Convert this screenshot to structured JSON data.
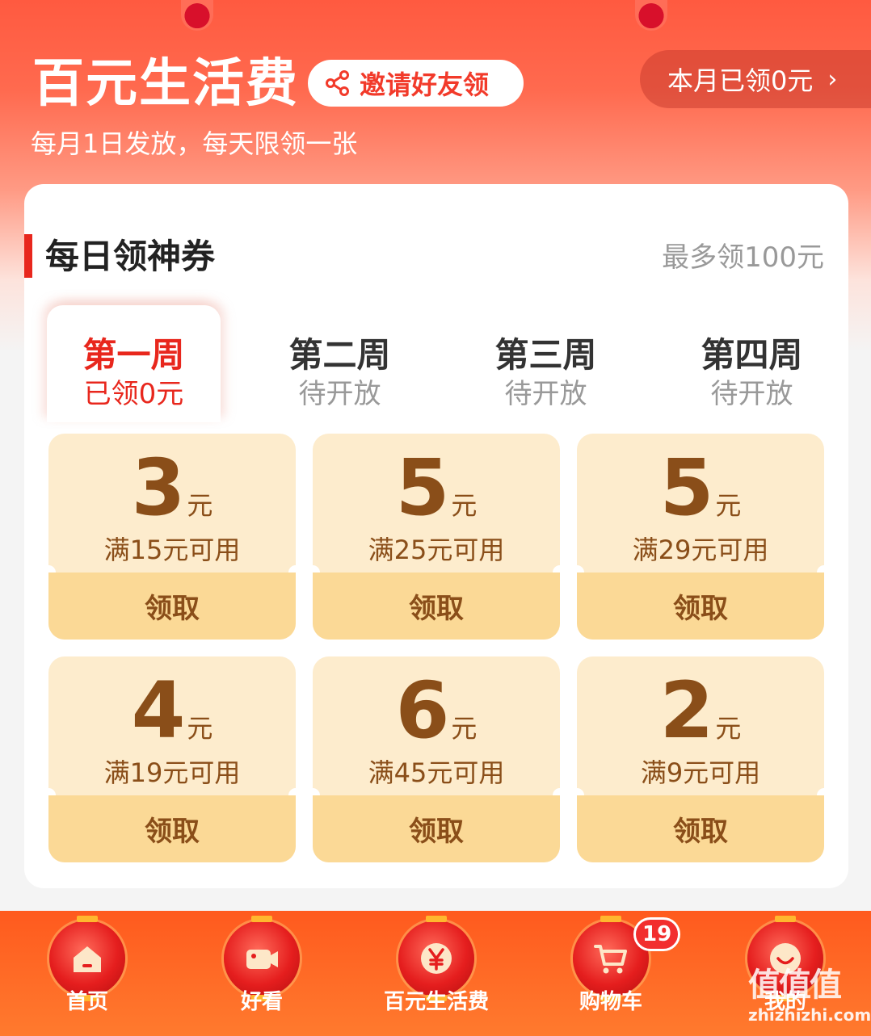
{
  "header": {
    "title": "百元生活费",
    "invite_label": "邀请好友领",
    "month_claimed": "本月已领0元",
    "month_chevron": "›",
    "subtitle": "每月1日发放，每天限领一张"
  },
  "section": {
    "title": "每日领神券",
    "limit": "最多领100元"
  },
  "weeks": [
    {
      "name": "第一周",
      "status": "已领0元",
      "active": true
    },
    {
      "name": "第二周",
      "status": "待开放",
      "active": false
    },
    {
      "name": "第三周",
      "status": "待开放",
      "active": false
    },
    {
      "name": "第四周",
      "status": "待开放",
      "active": false
    }
  ],
  "coupons": [
    {
      "amount": "3",
      "unit": "元",
      "condition": "满15元可用",
      "action": "领取"
    },
    {
      "amount": "5",
      "unit": "元",
      "condition": "满25元可用",
      "action": "领取"
    },
    {
      "amount": "5",
      "unit": "元",
      "condition": "满29元可用",
      "action": "领取"
    },
    {
      "amount": "4",
      "unit": "元",
      "condition": "满19元可用",
      "action": "领取"
    },
    {
      "amount": "6",
      "unit": "元",
      "condition": "满45元可用",
      "action": "领取"
    },
    {
      "amount": "2",
      "unit": "元",
      "condition": "满9元可用",
      "action": "领取"
    }
  ],
  "tabbar": [
    {
      "label": "首页",
      "icon": "home-icon"
    },
    {
      "label": "好看",
      "icon": "video-camera-icon"
    },
    {
      "label": "百元生活费",
      "icon": "yuan-coin-icon"
    },
    {
      "label": "购物车",
      "icon": "shopping-cart-icon",
      "badge": "19"
    },
    {
      "label": "我的",
      "icon": "smiley-face-icon"
    }
  ],
  "watermark": {
    "text": "值值值",
    "url": "zhizhizhi.com"
  },
  "colors": {
    "accent": "#e8271d",
    "coupon_bg": "#fdeccd",
    "coupon_button": "#fbd996",
    "coupon_text": "#8a4e19",
    "tabbar": "#ff5a1e"
  }
}
